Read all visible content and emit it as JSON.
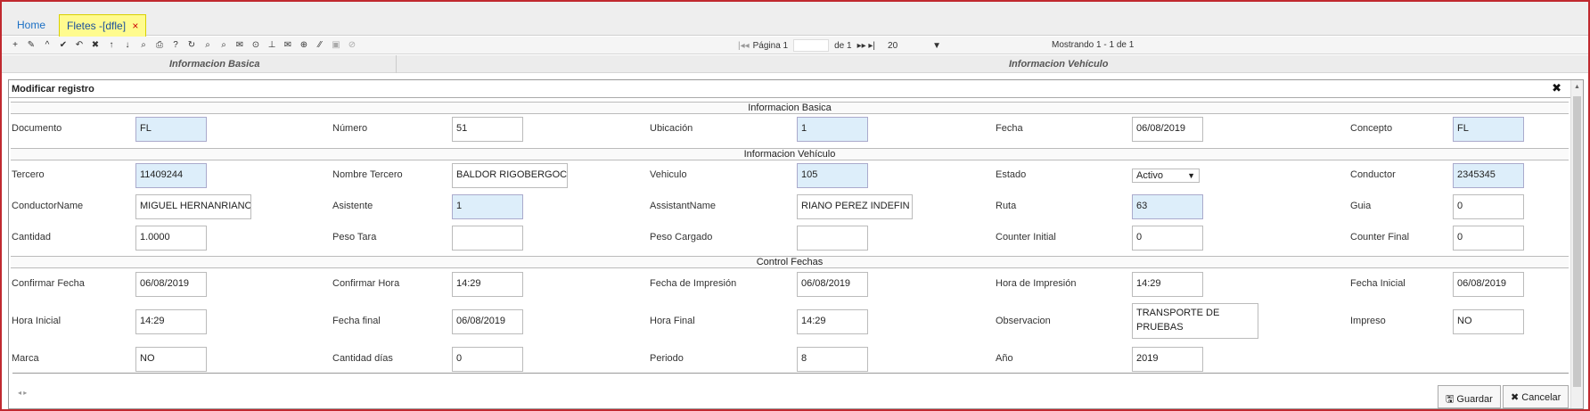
{
  "tabs": {
    "home": "Home",
    "active": "Fletes -[dfle]",
    "close": "×"
  },
  "toolbar": {
    "icons": [
      "+",
      "✎",
      "^",
      "✔",
      "↶",
      "✖",
      "↑",
      "↓",
      "⌕",
      "⎙",
      "?",
      "↻",
      "⌕",
      "⌕",
      "✉",
      "⊙",
      "⊥",
      "✉",
      "⊕",
      "⁄⁄",
      "▣",
      "⊘"
    ],
    "pager_first": "|◂◂",
    "pager_label": "Página 1",
    "pager_of": "de 1",
    "pager_next": "▸▸ ▸|",
    "page_size": "20",
    "page_size_arrow": "▼",
    "showing": "Mostrando 1 - 1 de 1"
  },
  "grid": {
    "group1": "Informacion Basica",
    "group2": "Informacion Vehículo"
  },
  "modal": {
    "title": "Modificar registro",
    "close": "✖",
    "sections": {
      "basica": "Informacion Basica",
      "vehiculo": "Informacion Vehículo",
      "fechas": "Control Fechas"
    },
    "fields": {
      "documento": {
        "label": "Documento",
        "value": "FL"
      },
      "numero": {
        "label": "Número",
        "value": "51"
      },
      "ubicacion": {
        "label": "Ubicación",
        "value": "1"
      },
      "fecha": {
        "label": "Fecha",
        "value": "06/08/2019"
      },
      "concepto": {
        "label": "Concepto",
        "value": "FL"
      },
      "tercero": {
        "label": "Tercero",
        "value": "11409244"
      },
      "nombre_tercero": {
        "label": "Nombre Tercero",
        "value": "BALDOR RIGOBERGOC"
      },
      "vehiculo": {
        "label": "Vehiculo",
        "value": "105"
      },
      "estado": {
        "label": "Estado",
        "value": "Activo"
      },
      "conductor": {
        "label": "Conductor",
        "value": "2345345"
      },
      "conductor_name": {
        "label": "ConductorName",
        "value": "MIGUEL HERNANRIANC"
      },
      "asistente": {
        "label": "Asistente",
        "value": "1"
      },
      "assistant_name": {
        "label": "AssistantName",
        "value": "RIANO PEREZ  INDEFIN"
      },
      "ruta": {
        "label": "Ruta",
        "value": "63"
      },
      "guia": {
        "label": "Guia",
        "value": "0"
      },
      "cantidad": {
        "label": "Cantidad",
        "value": "1.0000"
      },
      "peso_tara": {
        "label": "Peso Tara",
        "value": ""
      },
      "peso_cargado": {
        "label": "Peso Cargado",
        "value": ""
      },
      "counter_initial": {
        "label": "Counter Initial",
        "value": "0"
      },
      "counter_final": {
        "label": "Counter Final",
        "value": "0"
      },
      "confirmar_fecha": {
        "label": "Confirmar Fecha",
        "value": "06/08/2019"
      },
      "confirmar_hora": {
        "label": "Confirmar Hora",
        "value": "14:29"
      },
      "fecha_impresion": {
        "label": "Fecha de Impresión",
        "value": "06/08/2019"
      },
      "hora_impresion": {
        "label": "Hora de Impresión",
        "value": "14:29"
      },
      "fecha_inicial": {
        "label": "Fecha Inicial",
        "value": "06/08/2019"
      },
      "hora_inicial": {
        "label": "Hora Inicial",
        "value": "14:29"
      },
      "fecha_final": {
        "label": "Fecha final",
        "value": "06/08/2019"
      },
      "hora_final": {
        "label": "Hora Final",
        "value": "14:29"
      },
      "observacion": {
        "label": "Observacion",
        "value": "TRANSPORTE DE PRUEBAS"
      },
      "impreso": {
        "label": "Impreso",
        "value": "NO"
      },
      "marca": {
        "label": "Marca",
        "value": "NO"
      },
      "cantidad_dias": {
        "label": "Cantidad días",
        "value": "0"
      },
      "periodo": {
        "label": "Periodo",
        "value": "8"
      },
      "anio": {
        "label": "Año",
        "value": "2019"
      }
    },
    "estado_arrow": "▼",
    "nav_arrows": "◂  ▸",
    "save": "🖫 Guardar",
    "cancel": "✖ Cancelar"
  }
}
